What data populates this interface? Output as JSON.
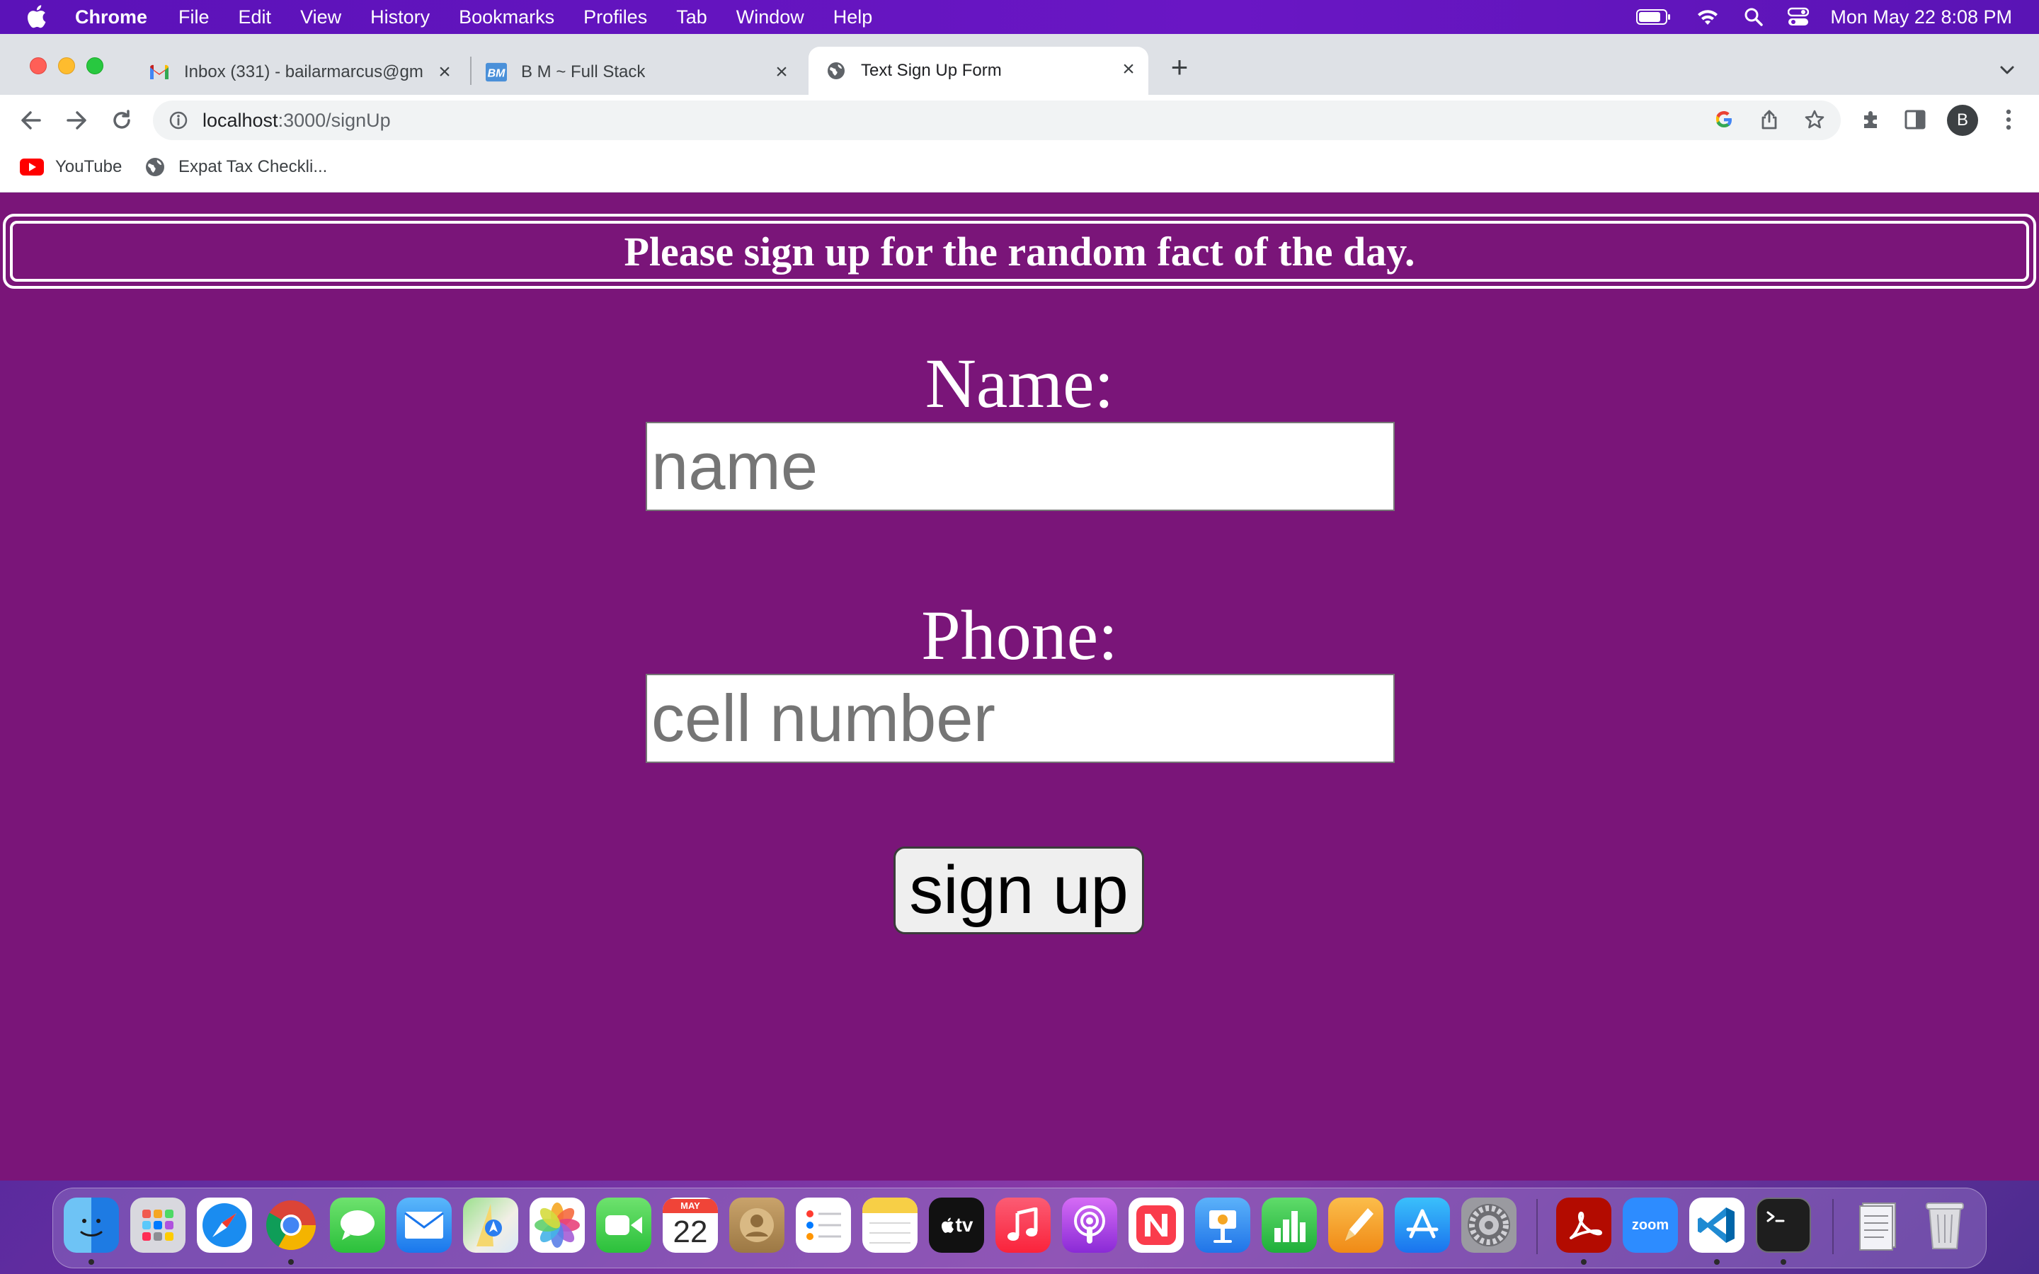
{
  "menubar": {
    "app_name": "Chrome",
    "menus": [
      "File",
      "Edit",
      "View",
      "History",
      "Bookmarks",
      "Profiles",
      "Tab",
      "Window",
      "Help"
    ],
    "clock": "Mon May 22  8:08 PM"
  },
  "tabs": [
    {
      "title": "Inbox (331) - bailarmarcus@gm",
      "favicon": "gmail-icon"
    },
    {
      "title": "B M ~ Full Stack",
      "favicon": "bm-logo-icon"
    },
    {
      "title": "Text Sign Up Form",
      "favicon": "globe-icon"
    }
  ],
  "toolbar": {
    "url_host": "localhost",
    "url_path": ":3000/signUp",
    "avatar_letter": "B"
  },
  "bookmarks": [
    {
      "label": "YouTube",
      "icon": "youtube-icon"
    },
    {
      "label": "Expat Tax Checkli...",
      "icon": "globe-icon"
    }
  ],
  "page": {
    "banner": "Please sign up for the random fact of the day.",
    "name_label": "Name:",
    "name_placeholder": "name",
    "phone_label": "Phone:",
    "phone_placeholder": "cell number",
    "submit_label": "sign up"
  },
  "dock": {
    "calendar_month": "MAY",
    "calendar_day": "22",
    "tv_label": "tv",
    "zoom_label": "zoom",
    "apps": [
      "finder",
      "launchpad",
      "safari",
      "chrome",
      "messages",
      "mail",
      "maps",
      "photos",
      "facetime",
      "calendar",
      "contacts",
      "reminders",
      "notes",
      "apple-tv",
      "music",
      "podcasts",
      "news",
      "keynote",
      "numbers",
      "pages",
      "app-store",
      "system-preferences",
      "acrobat",
      "zoom",
      "vscode",
      "terminal",
      "documents",
      "trash"
    ]
  },
  "colors": {
    "page_background": "#7a1579",
    "menubar": "#6a16c4",
    "tab_strip": "#dee1e6"
  }
}
